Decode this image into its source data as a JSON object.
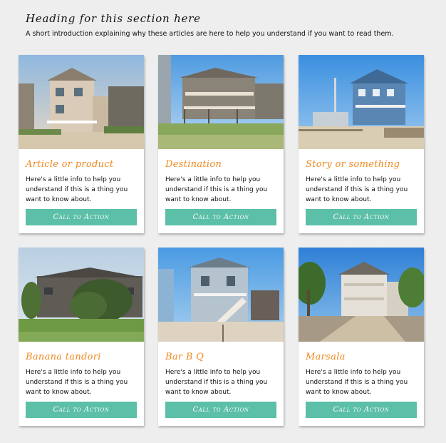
{
  "section": {
    "heading": "Heading for this section here",
    "intro": "A short introduction explaining why these articles are here to help you understand if you want to read them."
  },
  "colors": {
    "title": "#f0891e",
    "button": "#5cbfa8",
    "background": "#eeeeee"
  },
  "cards": [
    {
      "title": "Article or product",
      "text": "Here's a little info to help you understand if this is a thing you want to know about.",
      "cta": "Call to Action",
      "image": "beach-house-photo"
    },
    {
      "title": "Destination",
      "text": "Here's a little info to help you understand if this is a thing you want to know about.",
      "cta": "Call to Action",
      "image": "beach-house-photo"
    },
    {
      "title": "Story or something",
      "text": "Here's a little info to help you understand if this is a thing you want to know about.",
      "cta": "Call to Action",
      "image": "beach-house-photo"
    },
    {
      "title": "Banana tandori",
      "text": "Here's a little info to help you understand if this is a thing you want to know about.",
      "cta": "Call to Action",
      "image": "beach-house-photo"
    },
    {
      "title": "Bar B Q",
      "text": "Here's a little info to help you understand if this is a thing you want to know about.",
      "cta": "Call to Action",
      "image": "beach-house-photo"
    },
    {
      "title": "Marsala",
      "text": "Here's a little info to help you understand if this is a thing you want to know about.",
      "cta": "Call to Action",
      "image": "beach-house-photo"
    }
  ]
}
